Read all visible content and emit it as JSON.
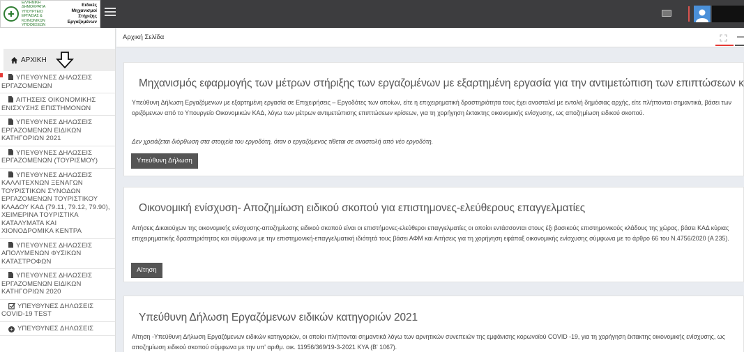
{
  "header": {
    "logo_emblem": "✚",
    "logo_ministry_text": "ΕΛΛΗΝΙΚΗ ΔΗΜΟΚΡΑΤΙΑ ΥΠΟΥΡΓΕΙΟ ΕΡΓΑΣΙΑΣ & ΚΟΙΝΩΝΙΚΩΝ ΥΠΟΘΕΣΕΩΝ",
    "logo_system_text": "Ειδικές Μηχανισμοί Στήριξης Εργαζομένων"
  },
  "breadcrumb": {
    "home": "Αρχική Σελίδα"
  },
  "sidebar": {
    "home_label": "ΑΡΧΙΚΗ",
    "items": [
      {
        "first": "ΥΠΕΥΘΥΝΕΣ ΔΗΛΩΣΕΙΣ",
        "rest": "ΕΡΓΑΖΟΜΕΝΩΝ",
        "icon": "document-icon"
      },
      {
        "first": "ΑΙΤΗΣΕΙΣ ΟΙΚΟΝΟΜΙΚΗΣ",
        "rest": "ΕΝΙΣΧΥΣΗΣ ΕΠΙΣΤΗΜΟΝΩΝ",
        "icon": "document-icon"
      },
      {
        "first": "ΥΠΕΥΘΥΝΕΣ ΔΗΛΩΣΕΙΣ",
        "rest": "ΕΡΓΑΖΟΜΕΝΩΝ ΕΙΔΙΚΩΝ ΚΑΤΗΓΟΡΙΩΝ 2021",
        "icon": "document-icon"
      },
      {
        "first": "ΥΠΕΥΘΥΝΕΣ ΔΗΛΩΣΕΙΣ",
        "rest": "ΕΡΓΑΖΟΜΕΝΩΝ (ΤΟΥΡΙΣΜΟΥ)",
        "icon": "document-icon"
      },
      {
        "first": "ΥΠΕΥΘΥΝΕΣ ΔΗΛΩΣΕΙΣ",
        "rest": "ΚΑΛΛΙΤΕΧΝΩΝ ΞΕΝΑΓΩΝ ΤΟΥΡΙΣΤΙΚΩΝ ΣΥΝΟΔΩΝ ΕΡΓΑΖΟΜΕΝΩΝ ΤΟΥΡΙΣΤΙΚΟΥ ΚΛΑΔΟΥ ΚΑΔ (79.11, 79.12, 79.90), ΧΕΙΜΕΡΙΝΑ ΤΟΥΡΙΣΤΙΚΑ ΚΑΤΑΛΥΜΑΤΑ ΚΑΙ ΧΙΟΝΟΔΡΟΜΙΚΑ ΚΕΝΤΡΑ",
        "icon": "document-icon"
      },
      {
        "first": "ΥΠΕΥΘΥΝΕΣ ΔΗΛΩΣΕΙΣ",
        "rest": "ΑΠΟΛΥΜΕΝΩΝ ΦΥΣΙΚΩΝ ΚΑΤΑΣΤΡΟΦΩΝ",
        "icon": "document-icon"
      },
      {
        "first": "ΥΠΕΥΘΥΝΕΣ ΔΗΛΩΣΕΙΣ",
        "rest": "ΕΡΓΑΖΟΜΕΝΩΝ ΕΙΔΙΚΩΝ ΚΑΤΗΓΟΡΙΩΝ 2020",
        "icon": "document-icon"
      },
      {
        "first": "ΥΠΕΥΘΥΝΕΣ ΔΗΛΩΣΕΙΣ",
        "rest": "COVID-19 TEST",
        "icon": "checkbox-icon"
      },
      {
        "first": "ΥΠΕΥΘΥΝΕΣ ΔΗΛΩΣΕΙΣ",
        "rest": "",
        "icon": "plus-circle-icon"
      }
    ]
  },
  "cards": [
    {
      "title": "Μηχανισμός εφαρμογής των μέτρων στήριξης των εργαζομένων με εξαρτημένη εργασία για την αντιμετώπιση των επιπτώσεων κρίσεων",
      "text": "Υπεύθυνη Δήλωση Εργαζόμενων με εξαρτημένη εργασία σε Επιχειρήσεις – Εργοδότες των οποίων, είτε η επιχειρηματική δραστηριότητα τους έχει ανασταλεί με εντολή δημόσιας αρχής, είτε πλήττονται σημαντικά, βάσει των οριζόμενων από το Υπουργείο Οικονομικών ΚΑΔ, λόγω των μέτρων αντιμετώπισης επιπτώσεων κρίσεων, για τη χορήγηση έκτακτης οικονομικής ενίσχυσης, ως αποζημίωση ειδικού σκοπού.",
      "note": "Δεν χρειάζεται διόρθωση στα στοιχεία του εργοδότη, όταν ο εργαζόμενος τίθεται σε αναστολή από νέο εργοδότη.",
      "button": "Υπεύθυνη Δήλωση"
    },
    {
      "title": "Οικονομική ενίσχυση- Αποζημίωση ειδικού σκοπού για επιστημονες-ελεύθερους επαγγελματίες",
      "text": "Αιτήσεις Δικαιούχων της οικονομικής ενίσχυσης-αποζημίωσης ειδικού σκοπού είναι οι επιστήμονες-ελεύθεροι επαγγελματίες οι οποίοι εντάσσονται στους έξι βασικούς επιστημονικούς κλάδους της χώρας, βάσει ΚΑΔ κύριας επιχειρηματικής δραστηριότητας και σύμφωνα με την επιστημονική-επαγγελματική ιδιότητά τους βάσει ΑΦΜ και Αιτήσεις για τη χορήγηση εφάπαξ οικονομικής ενίσχυσης σύμφωνα με το άρθρο 66 του Ν.4756/2020 (Α 235).",
      "button": "Αίτηση"
    },
    {
      "title": "Υπεύθυνη Δήλωση Εργαζόμενων ειδικών κατηγοριών 2021",
      "text": "Αίτηση -Υπεύθυνη Δήλωση Εργαζόμενων ειδικών κατηγοριών, οι οποίοι πλήττονται σημαντικά λόγω των αρνητικών συνεπειών της εμφάνισης κορωνοϊού COVID -19, για τη χορήγηση έκτακτης οικονομικής ενίσχυσης, ως αποζημίωση ειδικού σκοπού σύμφωνα με την υπ' αριθμ. οικ. 11956/369/19-3-2021 ΚΥΑ (Β' 1067)."
    }
  ]
}
